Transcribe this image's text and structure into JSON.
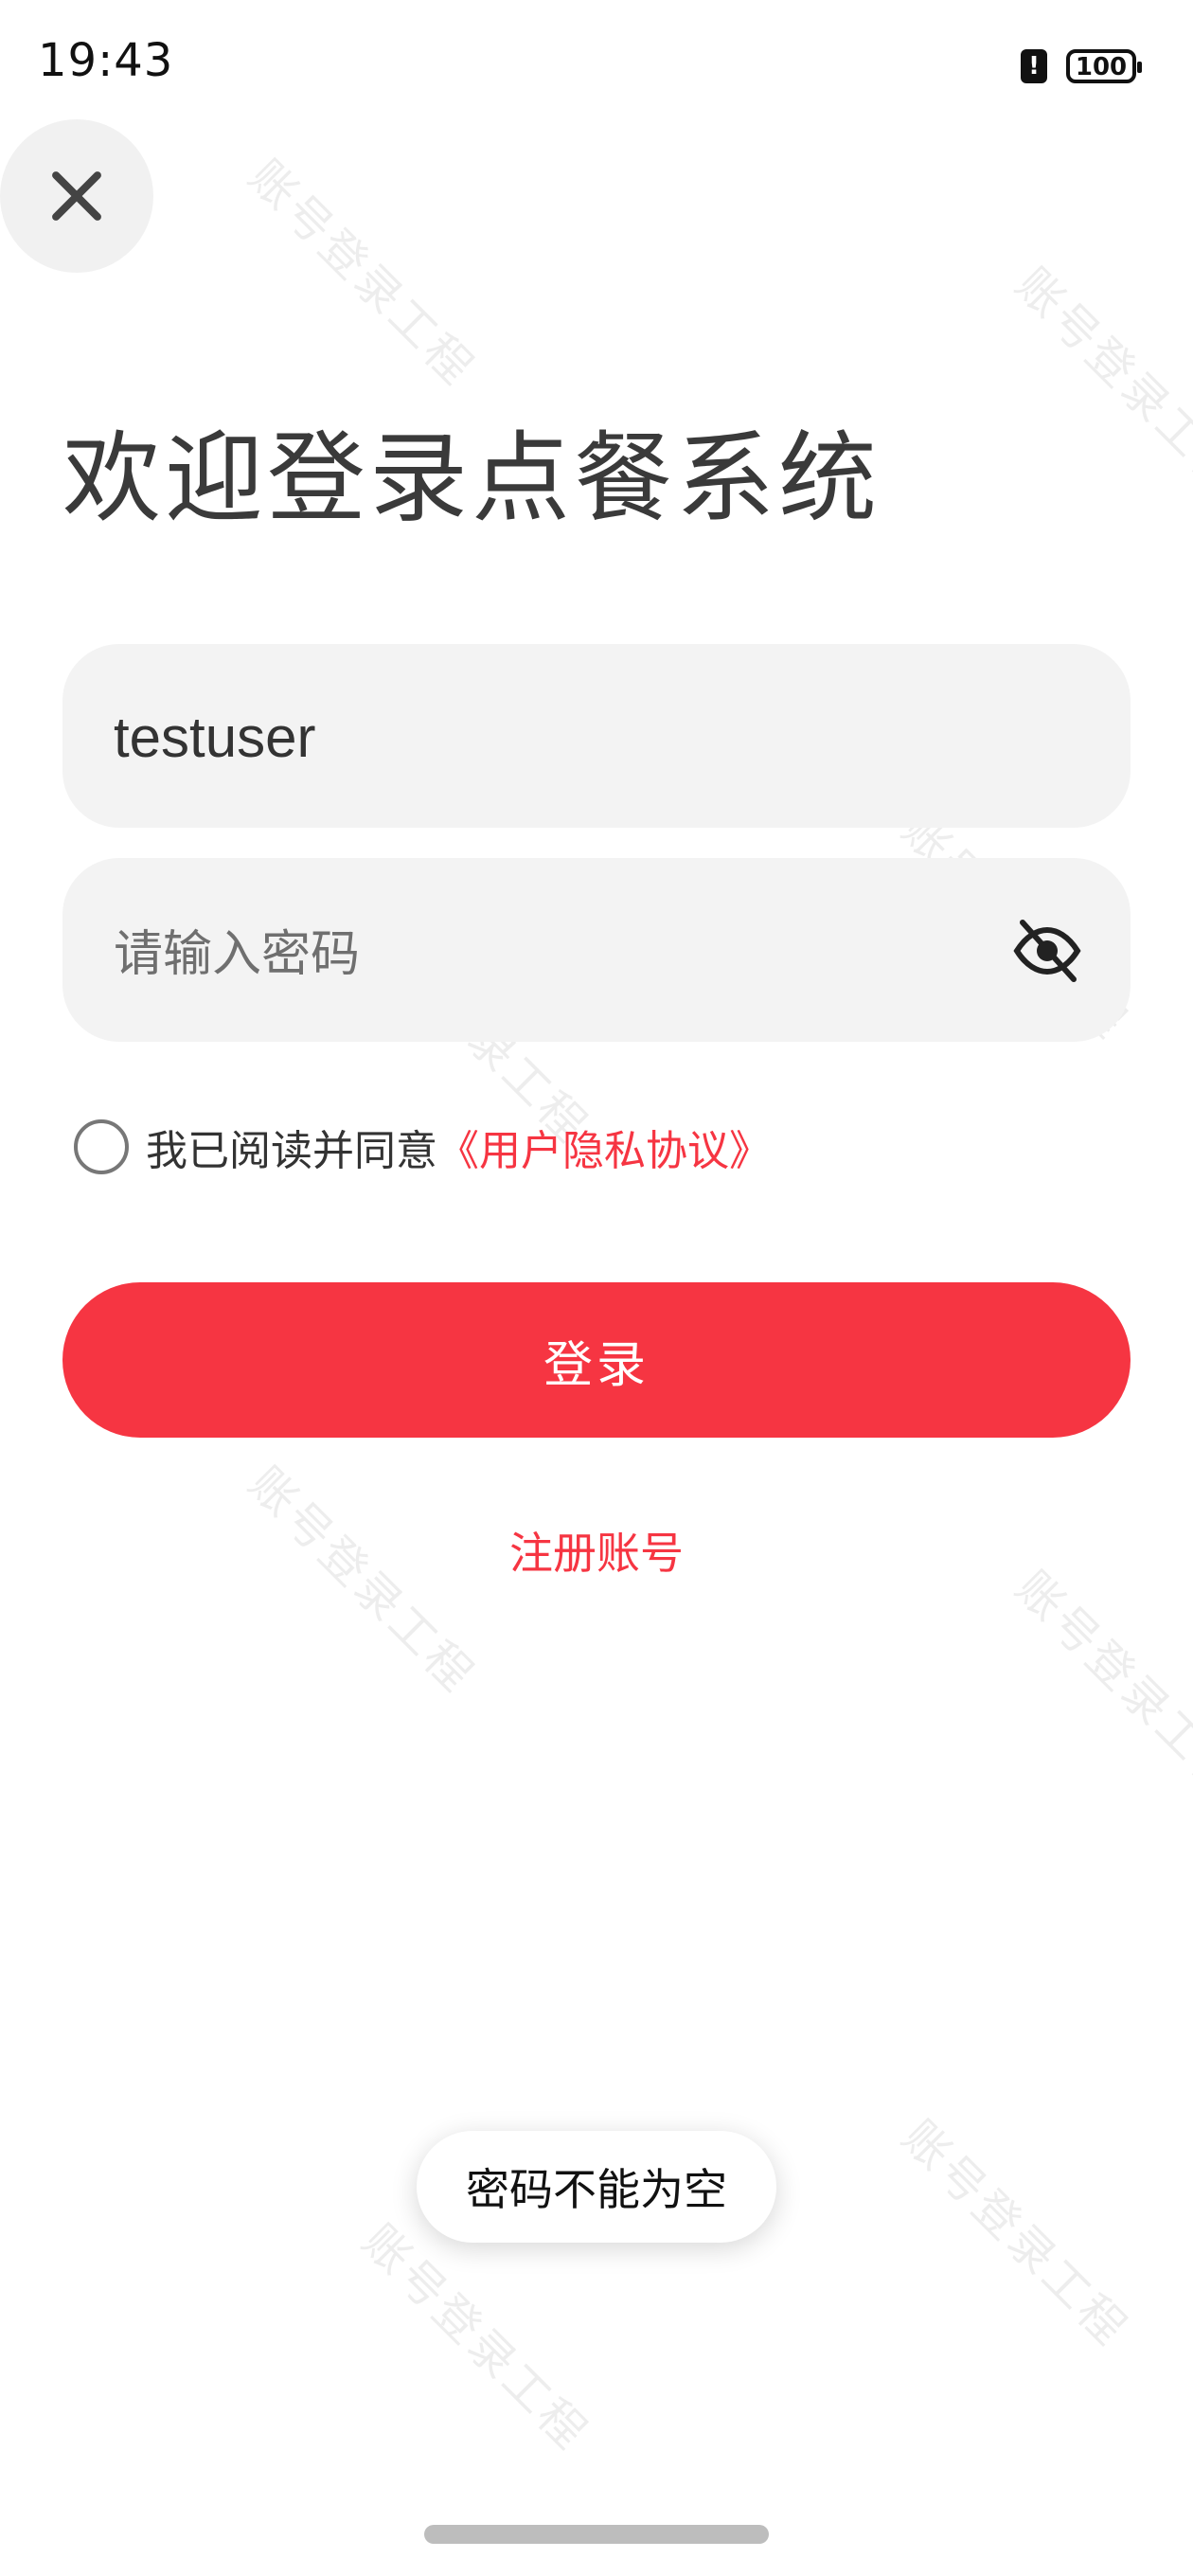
{
  "status_bar": {
    "time": "19:43",
    "battery": "100"
  },
  "login": {
    "title": "欢迎登录点餐系统",
    "username_value": "testuser",
    "password_placeholder": "请输入密码",
    "agree_text": "我已阅读并同意",
    "agreement_link": "《用户隐私协议》",
    "login_button": "登录",
    "register_link": "注册账号"
  },
  "toast": {
    "message": "密码不能为空"
  },
  "watermark": "账号登录工程",
  "colors": {
    "accent": "#f63542",
    "field_background": "#f3f3f3",
    "title": "#3a3a3a"
  },
  "icons": {
    "close": "close-icon",
    "password_visibility": "eye-off-icon",
    "alert": "alert-icon",
    "battery": "battery-icon"
  }
}
